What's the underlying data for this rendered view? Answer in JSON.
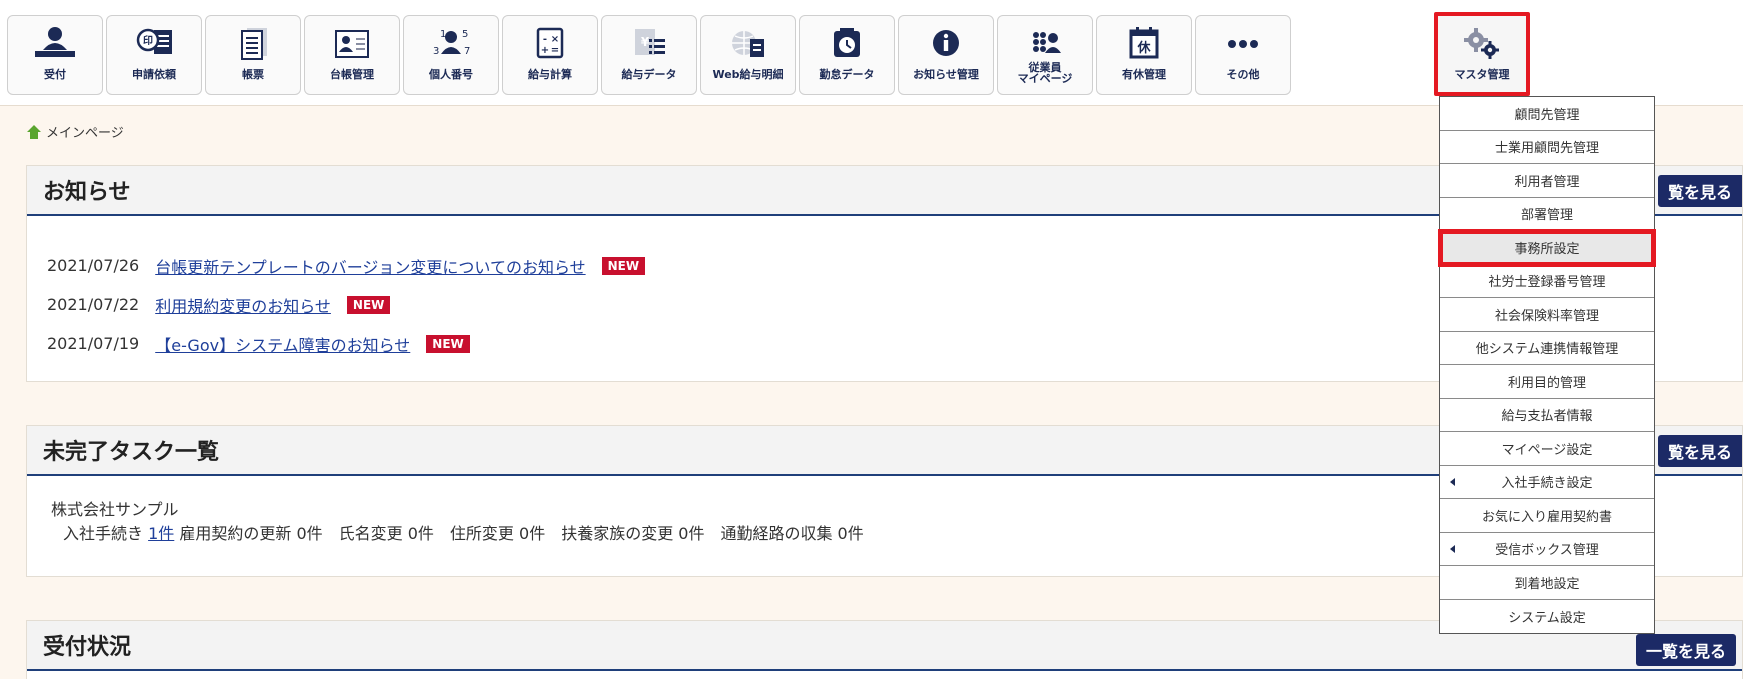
{
  "toolbar": {
    "items": [
      {
        "label": "受付",
        "icon": "reception-person-icon"
      },
      {
        "label": "申請依頼",
        "icon": "seal-document-icon"
      },
      {
        "label": "帳票",
        "icon": "form-document-icon"
      },
      {
        "label": "台帳管理",
        "icon": "ledger-card-icon"
      },
      {
        "label": "個人番号",
        "icon": "personal-number-icon"
      },
      {
        "label": "給与計算",
        "icon": "calculator-icon"
      },
      {
        "label": "給与データ",
        "icon": "payroll-data-icon"
      },
      {
        "label": "Web給与明細",
        "icon": "web-payslip-icon"
      },
      {
        "label": "勤怠データ",
        "icon": "attendance-clock-icon"
      },
      {
        "label": "お知らせ管理",
        "icon": "info-icon"
      },
      {
        "label": "従業員\nマイページ",
        "icon": "employee-mypage-icon"
      },
      {
        "label": "有休管理",
        "icon": "paid-leave-calendar-icon"
      },
      {
        "label": "その他",
        "icon": "more-dots-icon"
      },
      {
        "label": "マスタ管理",
        "icon": "gears-icon"
      }
    ],
    "accent": "#e41922",
    "label_color": "#1c2a55"
  },
  "breadcrumb": {
    "home_label": "メインページ",
    "icon": "home-icon"
  },
  "notices": {
    "title": "お知らせ",
    "view_all": "覧を見る",
    "items": [
      {
        "date": "2021/07/26",
        "text": "台帳更新テンプレートのバージョン変更についてのお知らせ",
        "badge": "NEW"
      },
      {
        "date": "2021/07/22",
        "text": "利用規約変更のお知らせ",
        "badge": "NEW"
      },
      {
        "date": "2021/07/19",
        "text": "【e-Gov】システム障害のお知らせ",
        "badge": "NEW"
      }
    ]
  },
  "tasks": {
    "title": "未完了タスク一覧",
    "view_all": "覧を見る",
    "company": "株式会社サンプル",
    "entry_label": "入社手続き",
    "entry_link": "1件",
    "rest": "雇用契約の更新 0件　氏名変更 0件　住所変更 0件　扶養家族の変更 0件　通勤経路の収集 0件"
  },
  "reception": {
    "title": "受付状況",
    "view_all": "一覧を見る"
  },
  "master_menu": {
    "items": [
      {
        "label": "顧問先管理"
      },
      {
        "label": "士業用顧問先管理"
      },
      {
        "label": "利用者管理"
      },
      {
        "label": "部署管理"
      },
      {
        "label": "事務所設定"
      },
      {
        "label": "社労士登録番号管理"
      },
      {
        "label": "社会保険料率管理"
      },
      {
        "label": "他システム連携情報管理"
      },
      {
        "label": "利用目的管理"
      },
      {
        "label": "給与支払者情報"
      },
      {
        "label": "マイページ設定"
      },
      {
        "label": "入社手続き設定"
      },
      {
        "label": "お気に入り雇用契約書"
      },
      {
        "label": "受信ボックス管理"
      },
      {
        "label": "到着地設定"
      },
      {
        "label": "システム設定"
      }
    ]
  }
}
